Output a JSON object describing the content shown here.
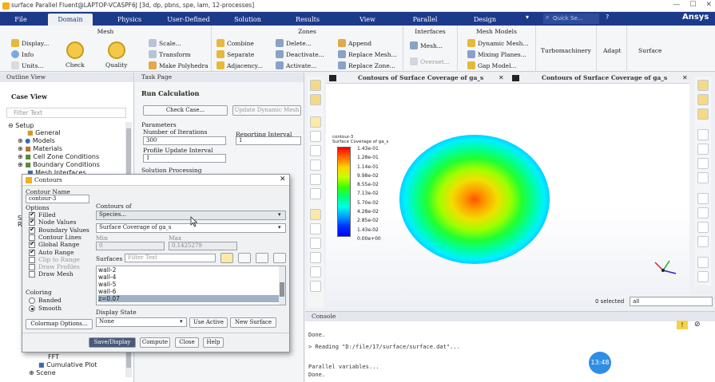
{
  "window": {
    "title": "surface Parallel Fluent@LAPTOP-VCASPF6J  [3d, dp, pbns, spe, lam, 12-processes]"
  },
  "menu": {
    "tabs": [
      "File",
      "Domain",
      "Physics",
      "User-Defined",
      "Solution",
      "Results",
      "View",
      "Parallel",
      "Design"
    ],
    "active": "Domain",
    "search_placeholder": "Quick Se...",
    "brand": "Ansys"
  },
  "ribbon": {
    "mesh": {
      "title": "Mesh",
      "display": "Display...",
      "info": "Info",
      "units": "Units...",
      "check": "Check",
      "quality": "Quality",
      "scale": "Scale...",
      "transform": "Transform",
      "polyhedra": "Make Polyhedra"
    },
    "zones": {
      "title": "Zones",
      "combine": "Combine",
      "separate": "Separate",
      "adjacency": "Adjacency...",
      "delete": "Delete...",
      "deactivate": "Deactivate...",
      "activate": "Activate...",
      "append": "Append",
      "replace_mesh": "Replace Mesh...",
      "replace_zone": "Replace Zone..."
    },
    "interfaces": {
      "title": "Interfaces",
      "mesh": "Mesh...",
      "overset": "Overset..."
    },
    "mesh_models": {
      "title": "Mesh Models",
      "dynamic": "Dynamic Mesh...",
      "mixing": "Mixing Planes...",
      "gap": "Gap Model..."
    },
    "turbo": "Turbomachinery",
    "adapt": "Adapt",
    "surface": "Surface"
  },
  "outline": {
    "header": "Outline View",
    "subheader": "Case View",
    "filter_placeholder": "Filter Text",
    "items": [
      "Setup",
      "General",
      "Models",
      "Materials",
      "Cell Zone Conditions",
      "Boundary Conditions",
      "Mesh Interfaces"
    ],
    "bottom_items": [
      "FFT",
      "Cumulative Plot",
      "Scene"
    ],
    "cut_labels": [
      "So",
      "Re"
    ]
  },
  "task": {
    "header": "Task Page",
    "title": "Run Calculation",
    "check_case": "Check Case...",
    "update_mesh": "Update Dynamic Mesh",
    "params_label": "Parameters",
    "iter_label": "Number of Iterations",
    "iter_value": "300",
    "report_label": "Reporting Interval",
    "report_value": "1",
    "profile_label": "Profile Update Interval",
    "profile_value": "1",
    "processing_label": "Solution Processing"
  },
  "graphics": {
    "tab1": "Contours of Surface Coverage of ga_s",
    "tab2": "Contours of Surface Coverage of ga_s",
    "legend": {
      "name": "contour-3",
      "quantity": "Surface Coverage of ga_s",
      "values": [
        "1.43e-01",
        "1.28e-01",
        "1.14e-01",
        "9.98e-02",
        "8.55e-02",
        "7.13e-02",
        "5.70e-02",
        "4.28e-02",
        "2.85e-02",
        "1.43e-02",
        "0.00e+00"
      ]
    },
    "selected_label": "0 selected",
    "selected_filter": "all"
  },
  "console": {
    "header": "Console",
    "lines": [
      "Done.",
      "> Reading \"D:/file/17/surface/surface.dat\"...",
      "Parallel variables...",
      "Done."
    ],
    "clock": "13:48"
  },
  "dialog": {
    "title": "Contours",
    "name_label": "Contour Name",
    "name_value": "contour-3",
    "options_label": "Options",
    "options": [
      {
        "label": "Filled",
        "checked": true,
        "enabled": true
      },
      {
        "label": "Node Values",
        "checked": true,
        "enabled": true
      },
      {
        "label": "Boundary Values",
        "checked": true,
        "enabled": true
      },
      {
        "label": "Contour Lines",
        "checked": false,
        "enabled": true
      },
      {
        "label": "Global Range",
        "checked": true,
        "enabled": true
      },
      {
        "label": "Auto Range",
        "checked": true,
        "enabled": true
      },
      {
        "label": "Clip to Range",
        "checked": false,
        "enabled": false
      },
      {
        "label": "Draw Profiles",
        "checked": false,
        "enabled": false
      },
      {
        "label": "Draw Mesh",
        "checked": false,
        "enabled": true
      }
    ],
    "coloring_label": "Coloring",
    "banded": "Banded",
    "smooth": "Smooth",
    "colormap_btn": "Colormap Options...",
    "contours_of_label": "Contours of",
    "species": "Species...",
    "quantity": "Surface Coverage of ga_s",
    "min_label": "Min",
    "min_value": "0",
    "max_label": "Max",
    "max_value": "0.1425279",
    "surfaces_label": "Surfaces",
    "surfaces_filter": "Filter Text",
    "surfaces": [
      "wall-2",
      "wall-4",
      "wall-5",
      "wall-6",
      "z=0.07"
    ],
    "display_state_label": "Display State",
    "display_state": "None",
    "use_active": "Use Active",
    "new_surface": "New Surface",
    "buttons": {
      "save": "Save/Display",
      "compute": "Compute",
      "close": "Close",
      "help": "Help"
    }
  }
}
